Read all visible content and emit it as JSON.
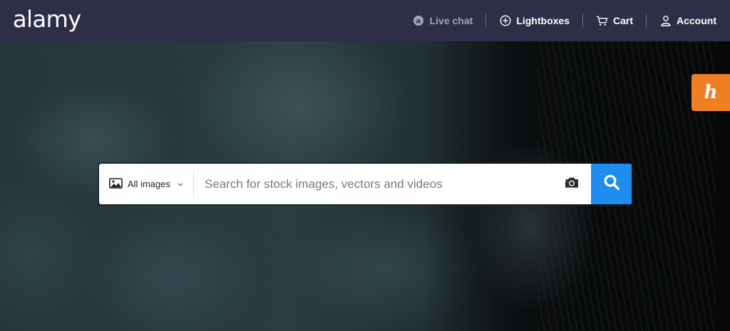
{
  "header": {
    "logo": "alamy",
    "nav": {
      "live_chat": "Live chat",
      "lightboxes": "Lightboxes",
      "cart": "Cart",
      "account": "Account"
    }
  },
  "search": {
    "type_selected": "All images",
    "placeholder": "Search for stock images, vectors and videos",
    "value": ""
  },
  "extension": {
    "glyph": "h"
  },
  "colors": {
    "header_bg": "#2f2e48",
    "search_button": "#1f8df0",
    "extension_tab": "#f07f24",
    "nav_muted": "#a3a3b5"
  },
  "icons": {
    "live_chat": "chat-bubble-icon",
    "lightboxes": "plus-circle-icon",
    "cart": "cart-icon",
    "account": "user-icon",
    "type_select": "image-icon",
    "visual_search": "camera-icon",
    "search": "magnifier-icon"
  }
}
